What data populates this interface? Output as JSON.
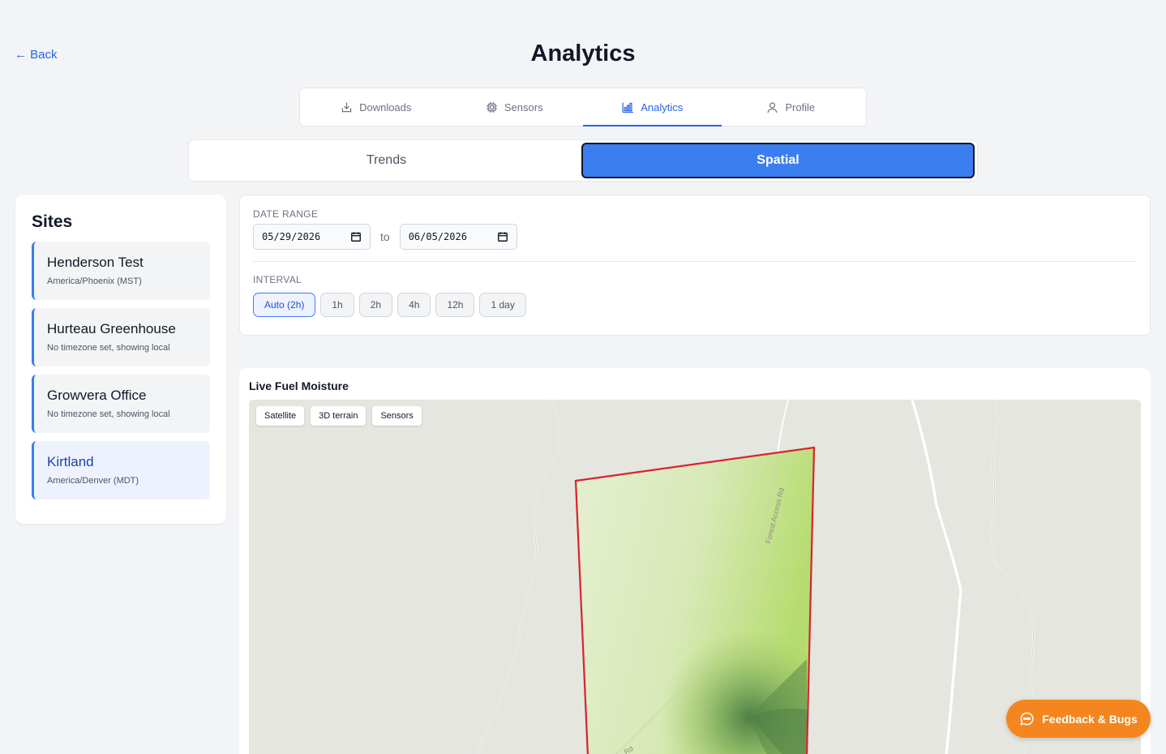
{
  "header": {
    "back_label": "← Back",
    "title": "Analytics"
  },
  "main_tabs": [
    {
      "label": "Downloads",
      "icon": "download-icon"
    },
    {
      "label": "Sensors",
      "icon": "chip-icon"
    },
    {
      "label": "Analytics",
      "icon": "bar-chart-icon",
      "active": true
    },
    {
      "label": "Profile",
      "icon": "user-icon"
    }
  ],
  "view_toggle": {
    "trends_label": "Trends",
    "spatial_label": "Spatial",
    "selected": "Spatial"
  },
  "sites": {
    "title": "Sites",
    "items": [
      {
        "name": "Henderson Test",
        "timezone": "America/Phoenix (MST)"
      },
      {
        "name": "Hurteau Greenhouse",
        "timezone": "No timezone set, showing local"
      },
      {
        "name": "Growvera Office",
        "timezone": "No timezone set, showing local"
      },
      {
        "name": "Kirtland",
        "timezone": "America/Denver (MDT)",
        "active": true
      }
    ]
  },
  "filters": {
    "date_range_label": "DATE RANGE",
    "start_date": "05/29/2026",
    "to_label": "to",
    "end_date": "06/05/2026",
    "interval_label": "INTERVAL",
    "intervals": [
      "Auto (2h)",
      "1h",
      "2h",
      "4h",
      "12h",
      "1 day"
    ],
    "selected_interval": "Auto (2h)"
  },
  "map": {
    "title": "Live Fuel Moisture",
    "controls": [
      "Satellite",
      "3D terrain",
      "Sensors"
    ],
    "road_labels": [
      "Forest Access Rd",
      "Rd"
    ],
    "colors": {
      "boundary": "#d9232e",
      "fill_light": "#dcebc0",
      "fill_dark": "#5a8a48"
    }
  },
  "feedback": {
    "label": "Feedback & Bugs",
    "color": "#f5861f"
  }
}
